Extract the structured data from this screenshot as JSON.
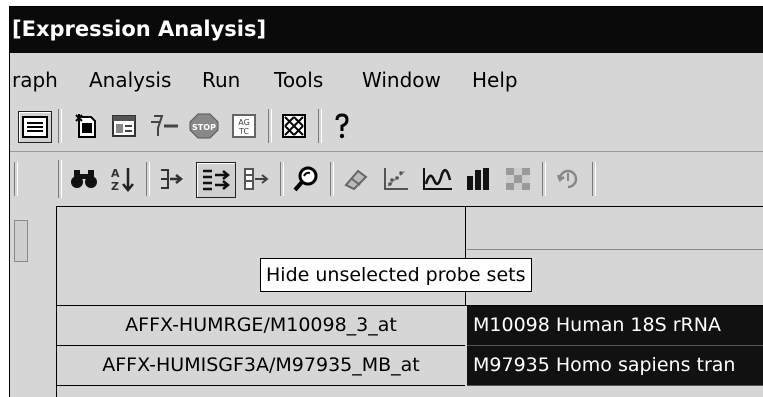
{
  "window": {
    "title": "[Expression Analysis]"
  },
  "menubar": {
    "items": [
      "raph",
      "Analysis",
      "Run",
      "Tools",
      "Window",
      "Help"
    ]
  },
  "toolbar_top": {
    "icons": [
      "list-view-icon",
      "new-document-icon",
      "window-icon",
      "filter-icon",
      "stop-icon",
      "sequence-icon",
      "pattern-icon",
      "help-icon"
    ]
  },
  "toolbar_bottom": {
    "icons": [
      "binoculars-icon",
      "sort-az-icon",
      "show-selected-icon",
      "hide-unselected-icon",
      "expand-icon",
      "zoom-icon",
      "eraser-icon",
      "scatter-plot-icon",
      "line-graph-icon",
      "bar-chart-icon",
      "heatmap-icon",
      "export-icon"
    ]
  },
  "tooltip": {
    "text": "Hide unselected probe sets"
  },
  "table": {
    "rows": [
      {
        "probe_set": "AFFX-HUMRGE/M10098_3_at",
        "description": "M10098 Human 18S rRNA"
      },
      {
        "probe_set": "AFFX-HUMISGF3A/M97935_MB_at",
        "description": "M97935 Homo sapiens tran"
      }
    ]
  },
  "colors": {
    "titlebar": "#0a0a0a",
    "chrome": "#d6d6d6",
    "selected_cell": "#111111"
  }
}
